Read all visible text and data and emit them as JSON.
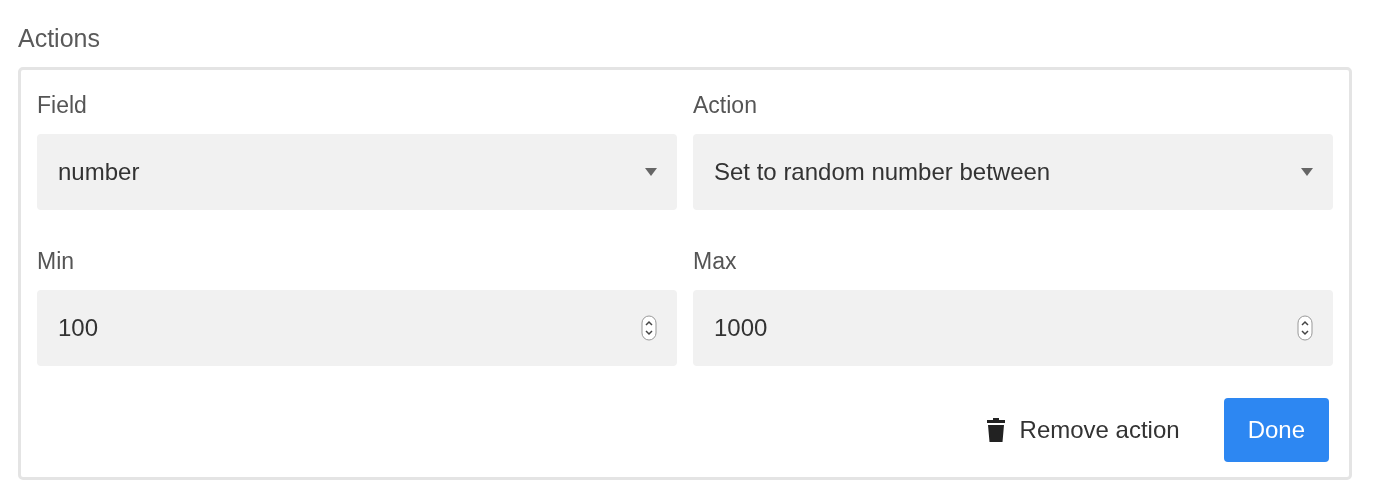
{
  "section_title": "Actions",
  "fields": [
    {
      "label": "Field",
      "kind": "select",
      "value": "number"
    },
    {
      "label": "Action",
      "kind": "select",
      "value": "Set to random number between"
    },
    {
      "label": "Min",
      "kind": "number",
      "value": "100"
    },
    {
      "label": "Max",
      "kind": "number",
      "value": "1000"
    }
  ],
  "buttons": [
    {
      "label": "Remove action",
      "kind": "link"
    },
    {
      "label": "Done",
      "kind": "primary"
    }
  ]
}
